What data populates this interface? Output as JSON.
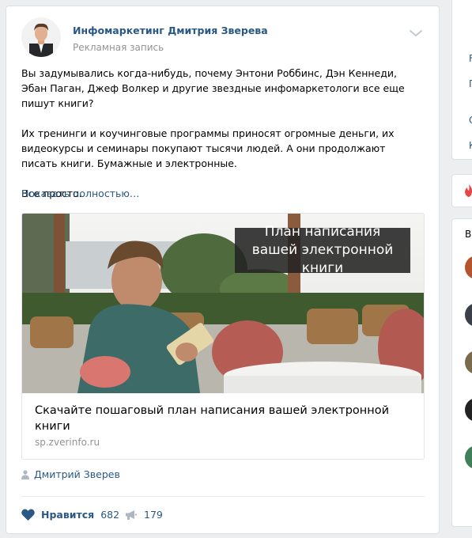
{
  "post": {
    "author": "Инфомаркетинг Дмитрия Зверева",
    "subtitle": "Рекламная запись",
    "paragraphs": [
      "Вы задумывались когда-нибудь, почему Энтони Роббинс, Дэн Кеннеди, Эбан Паган, Джеф Волкер и другие звездные инфомаркетологи все еще пишут книги?",
      "Их тренинги и коучинговые программы приносят огромные деньги, их видеокурсы и семинары покупают тысячи людей. А они продолжают писать книги. Бумажные и электронные.",
      "Все просто."
    ],
    "show_more": "Показать полностью…",
    "snippet": {
      "image_caption": "План написания вашей электронной книги",
      "title": "Скачайте пошаговый план написания вашей электронной книги",
      "domain": "sp.zverinfo.ru"
    },
    "signer": "Дмитрий Зверев",
    "likes_label": "Нравится",
    "likes_count": "682",
    "shares_count": "179"
  },
  "sidebar": {
    "items": [
      "F",
      "П",
      "С",
      "К"
    ],
    "section_label": "Во"
  },
  "colors": {
    "link": "#2a5885",
    "muted": "#939393",
    "background": "#edeef0",
    "like_heart": "#2a5885",
    "fire_icon": "#e64646"
  }
}
